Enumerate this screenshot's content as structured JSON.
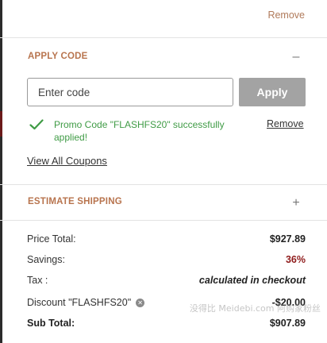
{
  "top_remove_label": "Remove",
  "apply_code": {
    "title": "APPLY CODE",
    "toggle_symbol": "–",
    "input_placeholder": "Enter code",
    "input_value": "",
    "apply_label": "Apply",
    "success_message": "Promo Code \"FLASHFS20\" successfully applied!",
    "remove_label": "Remove",
    "view_coupons_label": "View All Coupons",
    "success_icon": "checkmark-icon"
  },
  "estimate_shipping": {
    "title": "ESTIMATE SHIPPING",
    "toggle_symbol": "+"
  },
  "summary": {
    "price_total_label": "Price Total:",
    "price_total_value": "$927.89",
    "savings_label": "Savings:",
    "savings_value": "36%",
    "tax_label": "Tax :",
    "tax_value": "calculated in checkout",
    "discount_label": "Discount \"FLASHFS20\"",
    "discount_remove_icon": "close-circle-icon",
    "discount_value": "-$20.00",
    "subtotal_label": "Sub Total:",
    "subtotal_value": "$907.89"
  },
  "colors": {
    "accent": "#b8744e",
    "success": "#3f9b45",
    "savings": "#8f1c1c",
    "button_disabled": "#a3a3a3"
  },
  "watermark_text": "没得比 Meidebi.com 阿购家粉丝 "
}
